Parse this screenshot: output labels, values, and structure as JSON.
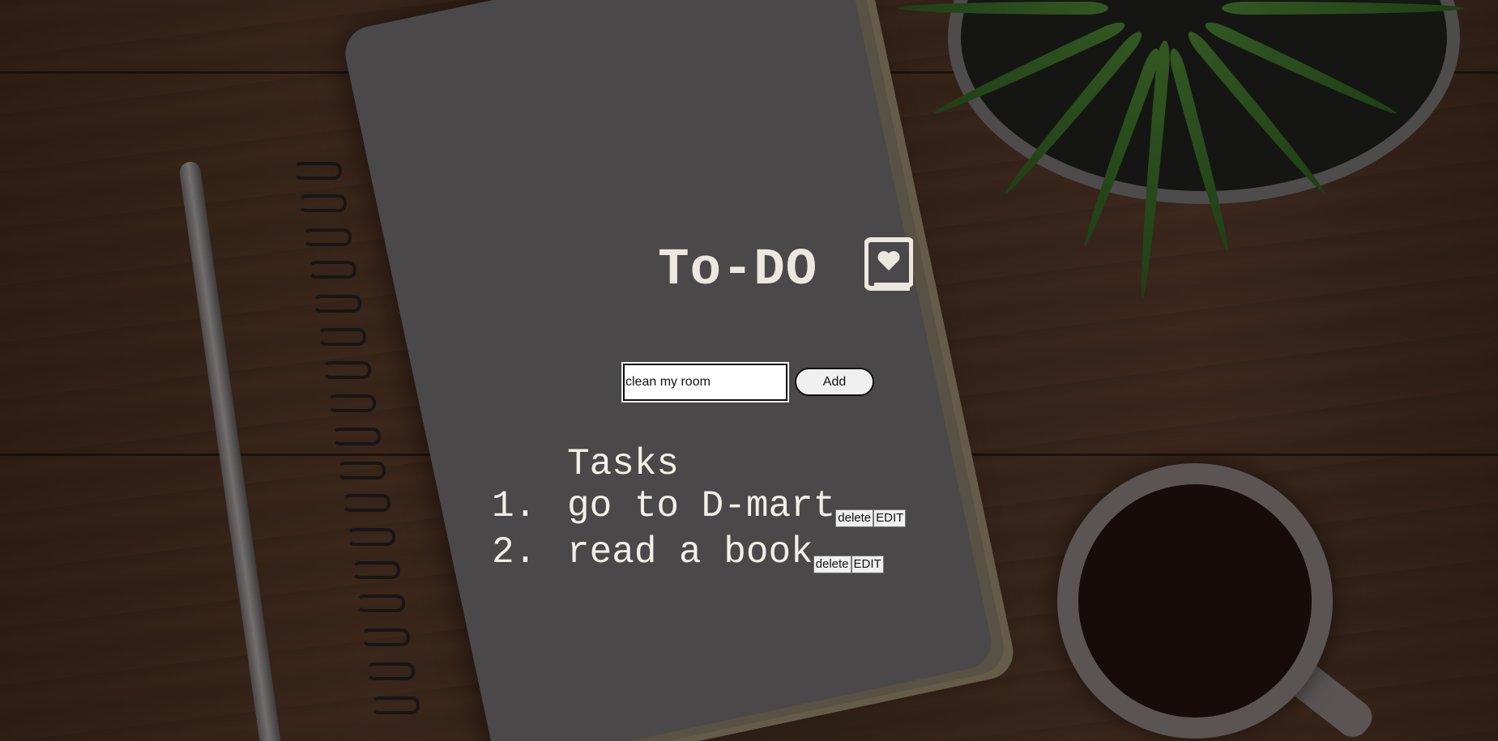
{
  "app": {
    "title": "To-DO",
    "title_icon": "book-heart-icon"
  },
  "add_form": {
    "input_value": "clean my room",
    "add_label": "Add"
  },
  "tasks": {
    "heading": "Tasks",
    "items": [
      {
        "number": "1.",
        "text": "go to D-mart",
        "delete_label": "delete",
        "edit_label": "EDIT"
      },
      {
        "number": "2.",
        "text": "read a book",
        "delete_label": "delete",
        "edit_label": "EDIT"
      }
    ]
  },
  "colors": {
    "title_text": "#ece8df",
    "task_text": "#f2efe8",
    "background_wood": "#3f2a1e",
    "notebook": "#5c585a"
  }
}
